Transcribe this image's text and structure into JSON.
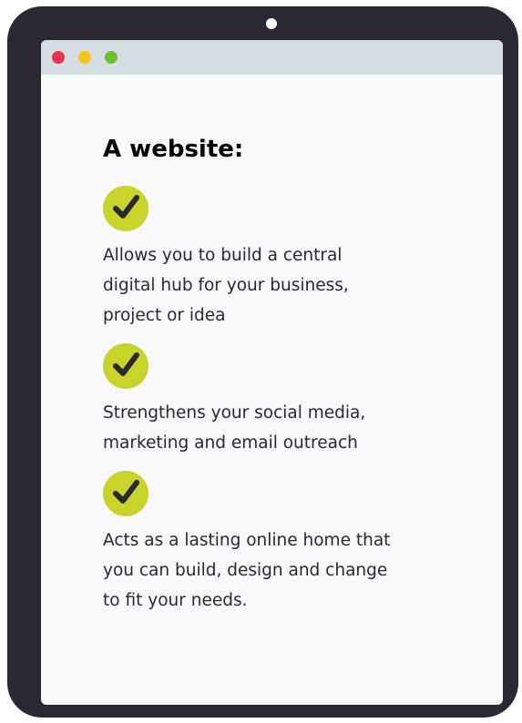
{
  "colors": {
    "frame": "#2a2832",
    "screen": "#f9f9fc",
    "title_bar": "#d5dde4",
    "check_bg": "#c8d42c",
    "dot_red": "#e8334a",
    "dot_yellow": "#f9c513",
    "dot_green": "#6ac22c"
  },
  "heading": "A website:",
  "items": [
    {
      "icon": "check-icon",
      "text": "Allows you to build a central\ndigital hub for your business,\nproject or idea"
    },
    {
      "icon": "check-icon",
      "text": "Strengthens your social media,\nmarketing and email outreach"
    },
    {
      "icon": "check-icon",
      "text": "Acts as a lasting online home that\nyou can build, design and change\nto fit your needs."
    }
  ]
}
